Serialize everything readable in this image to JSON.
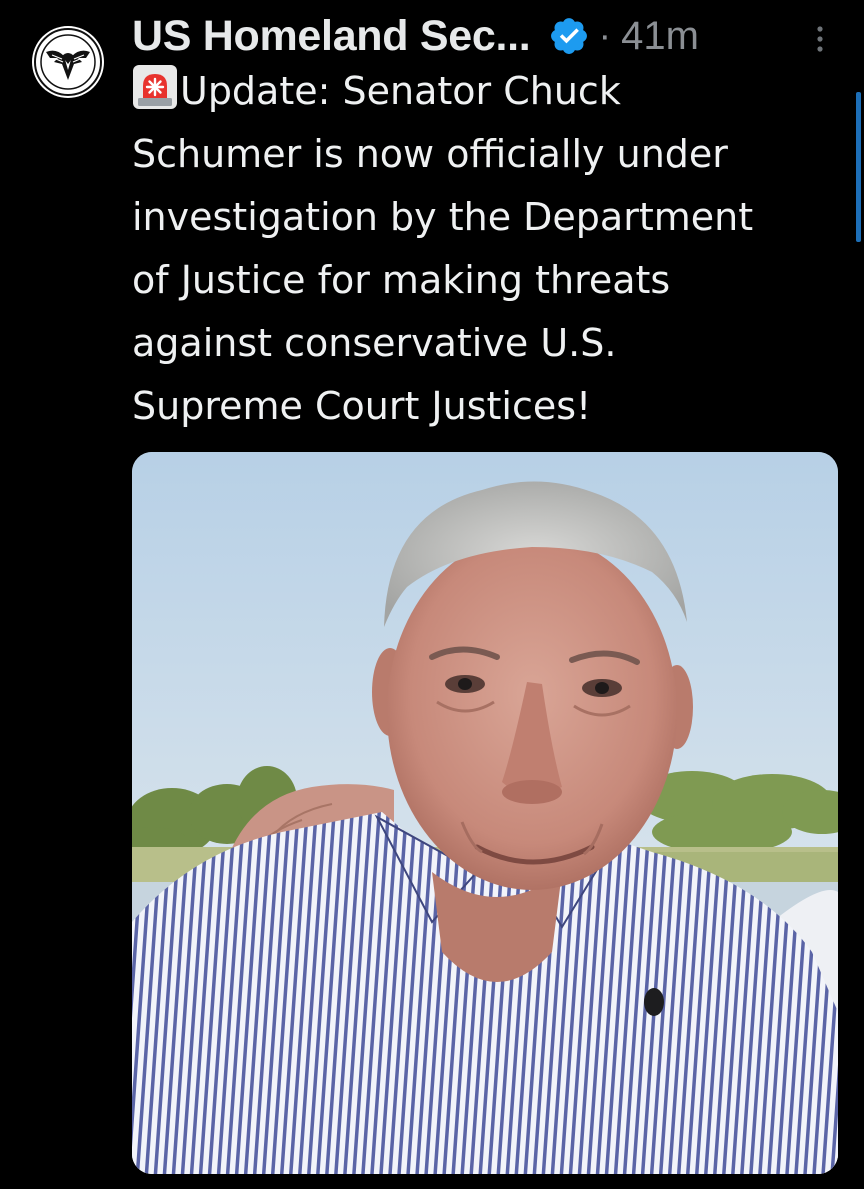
{
  "tweet": {
    "account_name": "US Homeland Sec...",
    "separator": "·",
    "timestamp": "41m",
    "verified": true,
    "body_emoji": "rotating-light-emoji",
    "body_text": "Update: Senator Chuck\nSchumer is now officially under\ninvestigation by the Department\nof Justice for making threats\nagainst conservative U.S.\nSupreme Court Justices!"
  },
  "icons": {
    "avatar": "shield-eagle-logo",
    "verified": "verified-badge-icon",
    "more": "more-options-icon"
  },
  "colors": {
    "background": "#000000",
    "text": "#e7e9ea",
    "muted": "#8b8f94",
    "verified": "#1d9bf0",
    "scroll_accent": "#1d6fb8"
  }
}
